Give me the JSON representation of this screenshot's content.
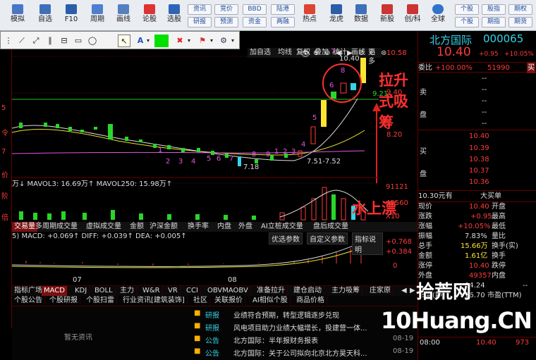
{
  "toolbar": {
    "items": [
      {
        "label": "模拟",
        "icon": "simulate-icon"
      },
      {
        "label": "自选",
        "icon": "watchlist-icon"
      },
      {
        "label": "F10",
        "icon": "f10-icon"
      },
      {
        "label": "周期",
        "icon": "period-icon"
      },
      {
        "label": "画线",
        "icon": "drawline-icon"
      },
      {
        "label": "论股",
        "icon": "discuss-icon"
      },
      {
        "label": "选股",
        "icon": "pickstock-icon"
      }
    ],
    "grid_buttons": [
      [
        "资讯",
        "竞价",
        "BBD",
        "陆港"
      ],
      [
        "研报",
        "预测",
        "资金",
        "两融"
      ]
    ],
    "items2": [
      {
        "label": "热点",
        "icon": "hot-icon"
      },
      {
        "label": "龙虎",
        "icon": "dragon-icon"
      },
      {
        "label": "数据",
        "icon": "data-icon"
      },
      {
        "label": "新股",
        "icon": "ipo-icon"
      },
      {
        "label": "创/科",
        "icon": "chuangke-icon"
      },
      {
        "label": "全球",
        "icon": "globe-icon"
      }
    ],
    "right_buttons": [
      [
        "个股",
        "股指",
        "期权"
      ],
      [
        "个股",
        "期指",
        "期货"
      ]
    ]
  },
  "drawbar": {
    "color_fill": "#00e000"
  },
  "chart": {
    "top_tabs": [
      "加自选",
      "均线",
      "复权",
      "叠加",
      "统计",
      "画线",
      "更多"
    ],
    "price_labels": [
      "10.58",
      "9.40",
      "8.20"
    ],
    "high_label": "10.40",
    "low_label": "7.18",
    "range_label": "7.51-7.52",
    "mark_label": "9.21",
    "annotation1": "拉升式吸筹",
    "annotation2": "水上漂",
    "count_nums_top": [
      "6",
      "7",
      "8"
    ],
    "count_nums_low": [
      "1",
      "2",
      "3",
      "4",
      "5",
      "6",
      "7",
      "8",
      "9",
      "1",
      "2",
      "3",
      "4",
      "5"
    ],
    "vol_line": "万↓ MAVOL3: 16.69万↑ MAVOL250: 15.98万↑",
    "vol_axis": [
      "91121",
      "45560",
      "X10"
    ],
    "main_tabs": [
      "交易量",
      "多周期成交量",
      "虚拟成交量",
      "金额",
      "沪深金额",
      "换手率",
      "内盘",
      "外盘",
      "AI立桩成交量",
      "盘后成交量"
    ],
    "macd_line_a": "5) MACD: +0.069↑ DIFF: +0.039↑ DEA: +0.005↑",
    "macd_buttons": [
      "优选参数",
      "自定义参数",
      "指标说明"
    ],
    "macd_axis": [
      "+0.768",
      "+0.384",
      "0"
    ],
    "x_labels": [
      "07",
      "08"
    ],
    "left_marks": [
      "5",
      "令",
      "7",
      "价",
      "阶",
      "倍"
    ]
  },
  "mode_tabs": [
    "指标广场",
    "MACD",
    "KDJ",
    "BOLL",
    "主力",
    "W&R",
    "VR",
    "CCI",
    "OBVMAOBV",
    "准备拉升",
    "建仓启动",
    "主力吸筹",
    "庄家原"
  ],
  "news_tabs": [
    "个股公告",
    "个股研报",
    "个股扫雷",
    "行业资讯[建筑装饰]",
    "社区",
    "关联报价",
    "AI相似个股",
    "商品价格"
  ],
  "news_empty": "暂无资讯",
  "news": [
    {
      "tag": "研报",
      "title": "业绩符合预期，转型逻辑逐步兑现",
      "date": ""
    },
    {
      "tag": "研报",
      "title": "风电项目助力业绩大幅增长，投建营一体...",
      "date": ""
    },
    {
      "tag": "公告",
      "title": "北方国际：半年报财务报表",
      "date": "08-19"
    },
    {
      "tag": "公告",
      "title": "北方国际：关于公司拟向北京北方昊天科...",
      "date": "08-19"
    }
  ],
  "quote": {
    "name": "北方国际",
    "code": "000065",
    "price": "10.40",
    "change": "+0.95",
    "pct": "+10.05%",
    "weibi_label": "委比",
    "weibi": "+100.00%",
    "weicha": "51990",
    "buy_flag": "买",
    "sell_labels": [
      "卖",
      "",
      "盘",
      ""
    ],
    "sell_rows": [
      "--",
      "--",
      "--",
      "--",
      "--"
    ],
    "buy_label": "买",
    "pan_label": "盘",
    "buy_rows": [
      [
        "10.40",
        ""
      ],
      [
        "10.39",
        ""
      ],
      [
        "10.38",
        ""
      ],
      [
        "10.37",
        ""
      ],
      [
        "10.36",
        ""
      ]
    ],
    "big_order": "10.30元有",
    "big_order2": "大买单",
    "stats": [
      [
        "现价",
        "10.40",
        "开盘",
        ""
      ],
      [
        "涨跌",
        "+0.95",
        "最高",
        ""
      ],
      [
        "涨幅",
        "+10.05%",
        "最低",
        ""
      ],
      [
        "振幅",
        "7.83%",
        "量比",
        ""
      ],
      [
        "总手",
        "15.66万",
        "换手(实)",
        ""
      ],
      [
        "金额",
        "1.61亿",
        "换手",
        ""
      ],
      [
        "涨停",
        "10.40",
        "跌停",
        ""
      ],
      [
        "外盘",
        "49357",
        "内盘",
        ""
      ],
      [
        "",
        "04.24",
        "",
        "--"
      ],
      [
        "市盈(静)",
        "16.70",
        "市盈(TTM)",
        ""
      ]
    ],
    "time": "08:00",
    "tick_price": "10.40",
    "tick_vol": "973"
  },
  "watermark": {
    "line1": "拾荒网",
    "line2": "10Huang.CN"
  }
}
